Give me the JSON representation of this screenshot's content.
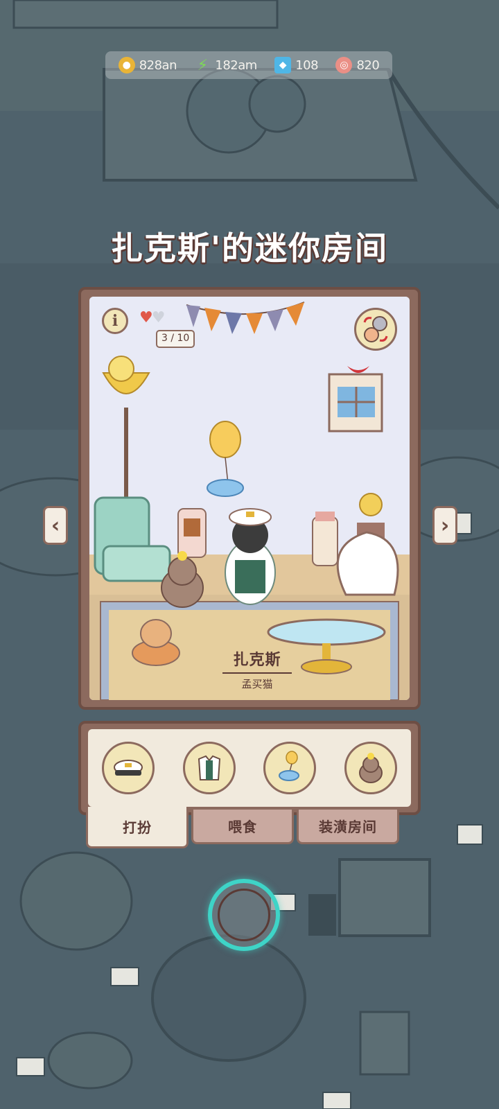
{
  "currency": {
    "coins": "828an",
    "energy": "182am",
    "gems": "108",
    "yarn": "820"
  },
  "room": {
    "title": "扎克斯'的迷你房间",
    "love_count": "3 / 10",
    "info_label": "i",
    "cat_name": "扎克斯",
    "cat_breed": "孟买猫"
  },
  "nav": {
    "prev": "‹",
    "next": "›"
  },
  "tabs": {
    "dress_up": "打扮",
    "feed": "喂食",
    "decorate": "装潢房间"
  },
  "icons": {
    "coin": "coin-icon",
    "energy": "lightning-icon",
    "gem": "gem-icon",
    "yarn": "yarn-icon"
  },
  "colors": {
    "accent": "#3ed4c7",
    "frame": "#8c6a5e",
    "panel": "#f1eadd"
  }
}
